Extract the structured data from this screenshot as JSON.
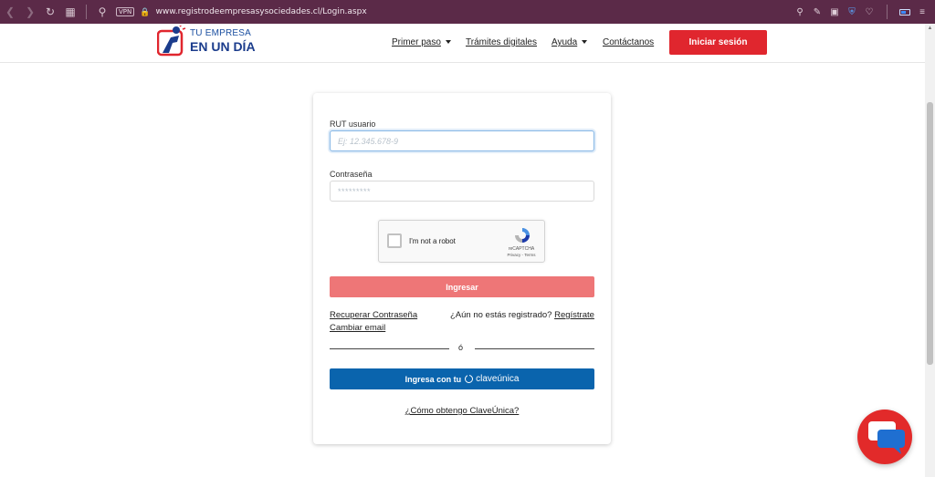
{
  "browser": {
    "vpn_label": "VPN",
    "url": "www.registrodeempresasysociedades.cl/Login.aspx"
  },
  "header": {
    "logo_line1": "TU EMPRESA",
    "logo_line2": "EN UN DÍA",
    "nav_items": [
      {
        "label": "Primer paso"
      },
      {
        "label": "Trámites digitales"
      },
      {
        "label": "Ayuda"
      },
      {
        "label": "Contáctanos"
      }
    ],
    "login_button": "Iniciar sesión"
  },
  "form": {
    "rut_label": "RUT usuario",
    "rut_placeholder": "Ej: 12.345.678-9",
    "password_label": "Contraseña",
    "password_placeholder": "*********",
    "captcha_text": "I'm not a robot",
    "captcha_brand": "reCAPTCHA",
    "captcha_terms": "Privacy - Terms",
    "submit_button": "Ingresar",
    "recover_password": "Recuperar Contraseña",
    "change_email": "Cambiar email",
    "not_registered": "¿Aún no estás registrado?",
    "register_link": "Regístrate",
    "divider_text": "ó",
    "clave_button_prefix": "Ingresa con tu",
    "clave_brand": "claveúnica",
    "clave_help": "¿Cómo obtengo ClaveÚnica?"
  },
  "colors": {
    "browser_bar": "#5b2a48",
    "brand_red": "#e0262e",
    "submit_disabled": "#ee7677",
    "clave_blue": "#0a64ad",
    "logo_blue": "#1b3c8c"
  }
}
